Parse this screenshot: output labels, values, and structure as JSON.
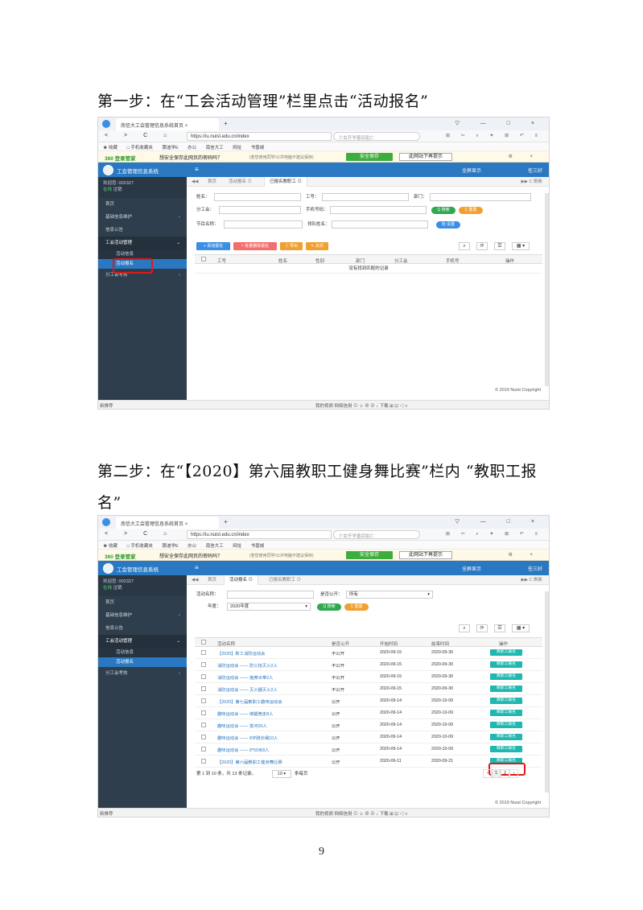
{
  "step1": {
    "heading": "第一步：在“工会活动管理”栏里点击“活动报名”"
  },
  "step2": {
    "heading": "第二步：在“【2020】第六届教职工健身舞比赛”栏内 “教职工报",
    "heading_cont": "名”"
  },
  "page_number": "9",
  "browser": {
    "tab_title": "南信大工会管理信息系统首页",
    "tab_close": "×",
    "new_tab": "+",
    "window_controls": "▽ — □ ×",
    "nav": "< > C ⌂",
    "url": "https://iu.nuist.edu.cn/index",
    "search_hint": "少女开学善目贴亡",
    "tools": "⊞ ✂ ⌕ ✦ ⊞ ↶ ≡",
    "bookmarks": [
      "★ 收藏",
      "□ 手机收藏夹",
      "跟迪学E",
      "办公",
      "南信大工",
      "网址",
      "书香城"
    ],
    "pw_brand": "360 登录管家",
    "pw_question": "想安全保存此网页的密码吗？",
    "pw_note": "(若您使用同学/公共电脑不建议保存)",
    "pw_save": "安全保存",
    "pw_never": "此网站下再提示",
    "pw_close": "⚙ ×",
    "status_left": "新推荐",
    "status_right": "我的视频   网络信用   ⊙  ☺  ⊕  ⊘   ↓ 下载   ⊞  ⊡  ◁  ⌕"
  },
  "app": {
    "title": "工会管理信息系统",
    "menu_icon": "≡",
    "fullscreen": "全屏显示",
    "user": "任三好",
    "welcome": "欢迎您: 002327",
    "online": "在线",
    "logout": "注销",
    "sidebar": [
      "首页",
      "基础信息维护",
      "信息公告",
      "工会活动管理",
      "活动信息",
      "活动报名",
      "分工会考核"
    ],
    "sub_arrow": "‹",
    "group_arrow": "⌄",
    "tabs_left": "◀◀",
    "tab_home": "首页",
    "tab_activity": "活动报名 ⊙",
    "tab_registered": "已报名教职工 ⊙",
    "tabs_right": "▶▶  C 刷新",
    "copyright": "© 2019 Nuist Copyright"
  },
  "screen1": {
    "filters": {
      "name": "姓名：",
      "id": "工号：",
      "dept": "部门：",
      "branch": "分工会：",
      "phone": "手机号码：",
      "program": "节目名称：",
      "leader": "领队姓名："
    },
    "search_btn": "Q 搜索",
    "reset_btn": "C 重置",
    "batch_set_btn": "批 设置",
    "toolbar": [
      "+ 添加报名",
      "× 批量删除报名",
      "⇩ 导出",
      "✎ 关闭"
    ],
    "tool_icons": [
      "⌕",
      "⟳",
      "☰",
      "▦ ▾"
    ],
    "columns": [
      "工号",
      "姓名",
      "性别",
      "部门",
      "分工会",
      "手机号",
      "操作"
    ],
    "empty_message": "没有找到匹配的记录"
  },
  "screen2": {
    "filters": {
      "activity_name": "活动名称：",
      "is_public": "是否公开：",
      "is_public_value": "所有",
      "year": "年度：",
      "year_value": "2020年度"
    },
    "search_btn": "Q 搜索",
    "reset_btn": "C 重置",
    "tool_icons": [
      "⌕",
      "⟳",
      "☰",
      "▦ ▾"
    ],
    "columns": [
      "活动名称",
      "是否公开",
      "开始时间",
      "结束时间",
      "操作"
    ],
    "action_label": "教职工报名",
    "rows": [
      {
        "name": "【2020】新工消防运动会",
        "public": "不公开",
        "start": "2020-09-15",
        "end": "2020-09-30"
      },
      {
        "name": "消防运动会 —— 防火抢灭火2人",
        "public": "不公开",
        "start": "2020-09-15",
        "end": "2020-09-30"
      },
      {
        "name": "消防运动会 —— 抱摩水带2人",
        "public": "不公开",
        "start": "2020-09-15",
        "end": "2020-09-30"
      },
      {
        "name": "消防运动会 —— 灭火器灭火2人",
        "public": "不公开",
        "start": "2020-09-15",
        "end": "2020-09-30"
      },
      {
        "name": "【2020】第七届教职工趣味运动会",
        "public": "公开",
        "start": "2020-09-14",
        "end": "2020-10-09"
      },
      {
        "name": "趣味运动会 —— 绑腿竞走8人",
        "public": "公开",
        "start": "2020-09-14",
        "end": "2020-10-09"
      },
      {
        "name": "趣味运动会 —— 拔河20人",
        "public": "公开",
        "start": "2020-09-14",
        "end": "2020-10-09"
      },
      {
        "name": "趣味运动会 —— 8字跳长绳10人",
        "public": "公开",
        "start": "2020-09-14",
        "end": "2020-10-09"
      },
      {
        "name": "趣味运动会 —— 8*50米8人",
        "public": "公开",
        "start": "2020-09-14",
        "end": "2020-10-09"
      },
      {
        "name": "【2020】第六届教职工健身舞比赛",
        "public": "公开",
        "start": "2020-09-11",
        "end": "2020-09-21"
      }
    ],
    "pagination_text": "第 1 到 10 条，共 13 条记录。",
    "page_size": "10 ▾",
    "page_size_suffix": "条每页",
    "pages": [
      "‹",
      "1",
      "2",
      "›"
    ]
  }
}
